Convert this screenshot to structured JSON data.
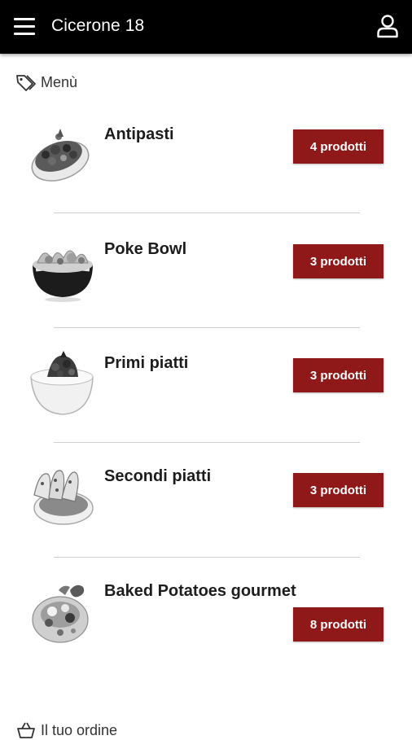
{
  "header": {
    "title": "Cicerone 18"
  },
  "menu_section": {
    "label": "Menù"
  },
  "categories": [
    {
      "name": "Antipasti",
      "count_label": "4 prodotti",
      "image": "bruschetta-dish"
    },
    {
      "name": "Poke Bowl",
      "count_label": "3 prodotti",
      "image": "poke-bowl-dish"
    },
    {
      "name": "Primi piatti",
      "count_label": "3 prodotti",
      "image": "pasta-bowl-dish"
    },
    {
      "name": "Secondi piatti",
      "count_label": "3 prodotti",
      "image": "stuffed-vegetables-dish"
    },
    {
      "name": "Baked Potatoes gourmet",
      "count_label": "8 prodotti",
      "image": "baked-potato-dish"
    }
  ],
  "order_section": {
    "label": "Il tuo ordine"
  },
  "colors": {
    "appbar": "#000000",
    "badge": "#8f1818",
    "divider": "#cfcfcf"
  }
}
